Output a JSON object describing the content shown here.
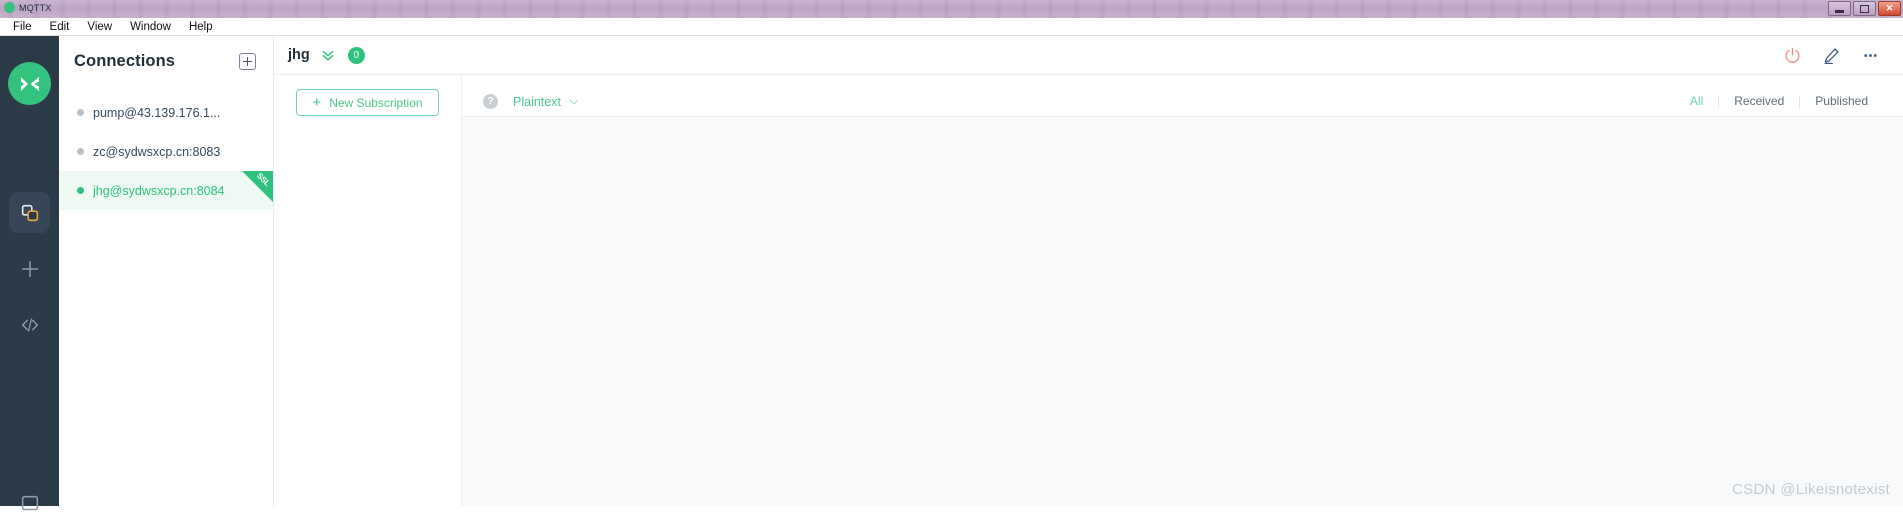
{
  "os": {
    "app_title": "MQTTX",
    "window_buttons": {
      "minimize": "minimize-button",
      "maximize": "maximize-button",
      "close": "✕"
    }
  },
  "menubar": {
    "items": [
      "File",
      "Edit",
      "View",
      "Window",
      "Help"
    ]
  },
  "rail": {
    "logo_name": "mqttx-logo",
    "items": [
      {
        "name": "connections-icon",
        "active": true
      },
      {
        "name": "new-connection-icon",
        "active": false
      },
      {
        "name": "code-script-icon",
        "active": false
      }
    ]
  },
  "sidebar": {
    "title": "Connections",
    "add_button_label": "+",
    "items": [
      {
        "label": "pump@43.139.176.1...",
        "status": "offline",
        "selected": false,
        "ssl": false
      },
      {
        "label": "zc@sydwsxcp.cn:8083",
        "status": "offline",
        "selected": false,
        "ssl": false
      },
      {
        "label": "jhg@sydwsxcp.cn:8084",
        "status": "online",
        "selected": true,
        "ssl": true,
        "ssl_badge": "SSL"
      }
    ]
  },
  "header": {
    "title": "jhg",
    "message_count": "0",
    "actions": [
      {
        "name": "disconnect-power-icon",
        "color": "#f08a8a"
      },
      {
        "name": "edit-pencil-icon",
        "color": "#3d5a80"
      },
      {
        "name": "more-options-icon",
        "color": "#3d5a80"
      }
    ]
  },
  "subscriptions": {
    "new_subscription_label": "New Subscription",
    "plus_glyph": "+"
  },
  "messages": {
    "help_glyph": "?",
    "format_label": "Plaintext",
    "filters": [
      {
        "label": "All",
        "active": true
      },
      {
        "label": "Received",
        "active": false
      },
      {
        "label": "Published",
        "active": false
      }
    ]
  },
  "watermark": "CSDN @Likeisnotexist",
  "colors": {
    "brand_green": "#2ec27e",
    "rail_dark": "#2b3a47",
    "selected_bg": "#eef9f4",
    "message_bg": "#f7f9fb"
  }
}
